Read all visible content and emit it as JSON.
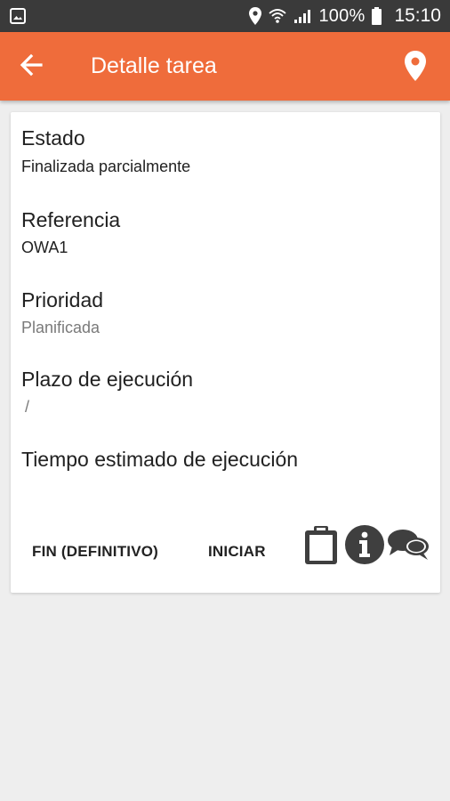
{
  "status_bar": {
    "battery_percent": "100%",
    "time": "15:10",
    "icons": [
      "gallery-icon",
      "location-icon",
      "wifi-icon",
      "signal-icon",
      "battery-icon"
    ]
  },
  "app_bar": {
    "title": "Detalle tarea",
    "back_icon": "arrow-back-icon",
    "map_icon": "location-pin-icon",
    "color": "#ef6c3b"
  },
  "fields": [
    {
      "label": "Estado",
      "value": "Finalizada parcialmente"
    },
    {
      "label": "Referencia",
      "value": "OWA1"
    },
    {
      "label": "Prioridad",
      "value": "Planificada"
    },
    {
      "label": "Plazo de ejecución",
      "value": "/"
    },
    {
      "label": "Tiempo estimado de ejecución",
      "value": ""
    }
  ],
  "actions": {
    "end_label": "FIN (DEFINITIVO)",
    "start_label": "INICIAR",
    "icons": [
      "clipboard-icon",
      "info-icon",
      "chat-icon"
    ]
  }
}
